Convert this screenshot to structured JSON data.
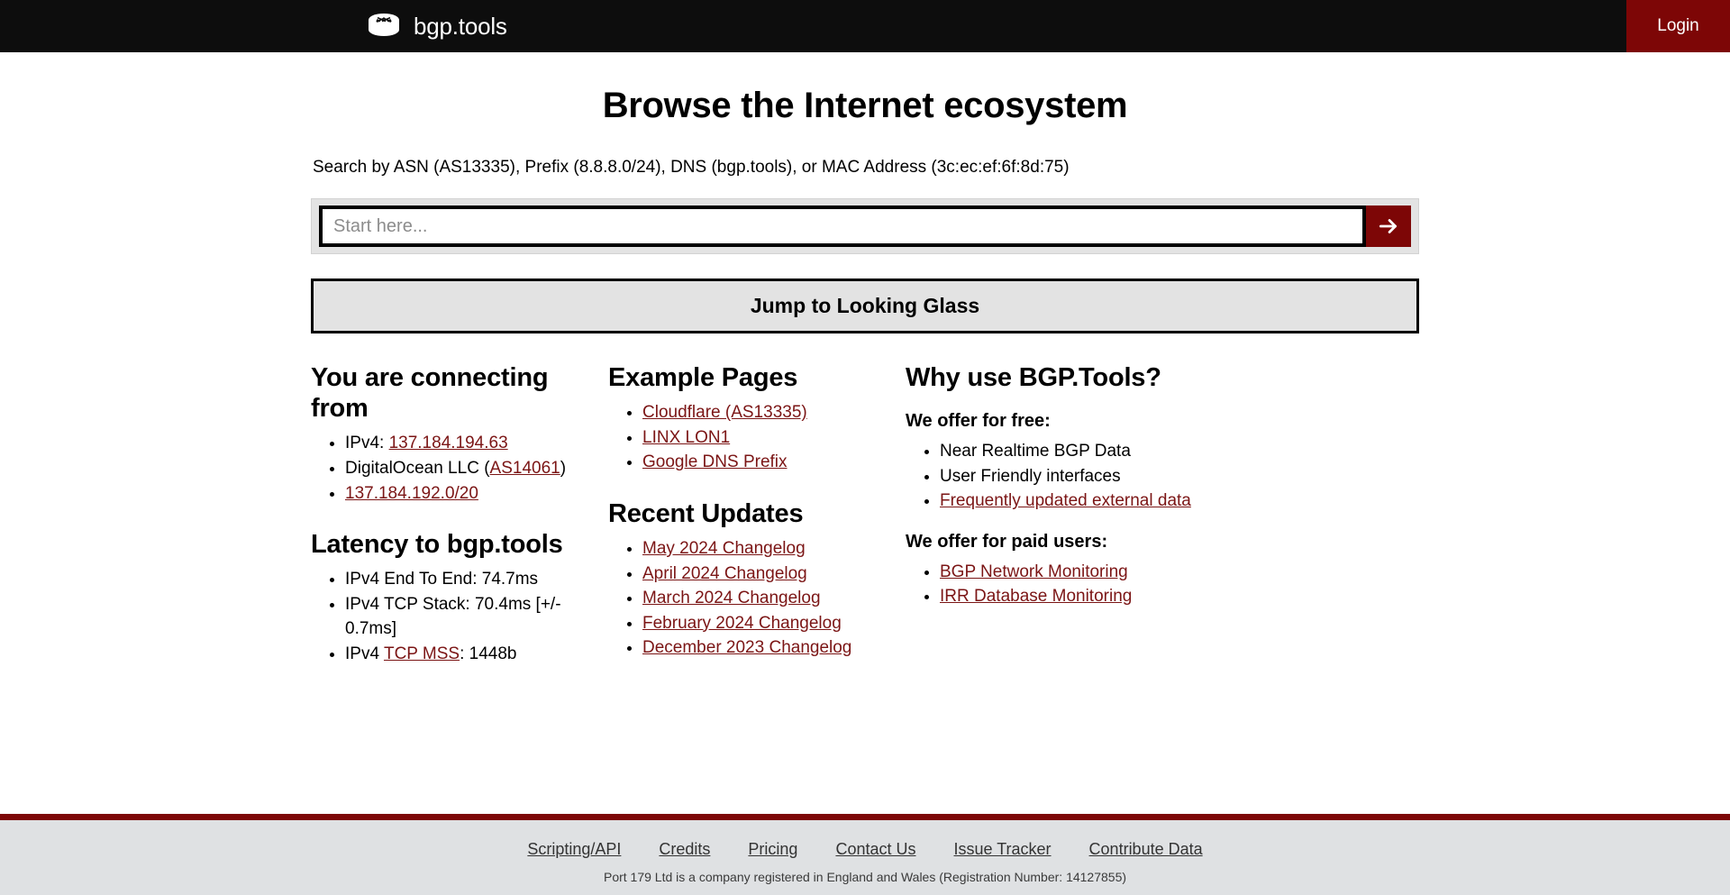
{
  "header": {
    "logo_icon": "router-icon",
    "brand": "bgp.tools",
    "login_label": "Login"
  },
  "hero": {
    "title": "Browse the Internet ecosystem",
    "search_description": "Search by ASN (AS13335), Prefix (8.8.8.0/24), DNS (bgp.tools), or MAC Address (3c:ec:ef:6f:8d:75)"
  },
  "search": {
    "placeholder": "Start here...",
    "value": "",
    "submit_icon": "arrow-right-icon"
  },
  "looking_glass": {
    "label": "Jump to Looking Glass"
  },
  "connecting_from": {
    "heading": "You are connecting from",
    "ipv4_label": "IPv4: ",
    "ipv4_value": "137.184.194.63",
    "org_name": "DigitalOcean LLC (",
    "org_asn": "AS14061",
    "org_close": ")",
    "prefix": "137.184.192.0/20"
  },
  "latency": {
    "heading": "Latency to bgp.tools",
    "end_to_end": "IPv4 End To End: 74.7ms",
    "tcp_stack": "IPv4 TCP Stack: 70.4ms [+/- 0.7ms]",
    "mss_prefix": "IPv4 ",
    "mss_link": "TCP MSS",
    "mss_value": ": 1448b"
  },
  "example_pages": {
    "heading": "Example Pages",
    "items": [
      {
        "label": "Cloudflare (AS13335)"
      },
      {
        "label": "LINX LON1"
      },
      {
        "label": "Google DNS Prefix"
      }
    ]
  },
  "recent_updates": {
    "heading": "Recent Updates",
    "items": [
      {
        "label": "May 2024 Changelog"
      },
      {
        "label": "April 2024 Changelog"
      },
      {
        "label": "March 2024 Changelog"
      },
      {
        "label": "February 2024 Changelog"
      },
      {
        "label": "December 2023 Changelog"
      }
    ]
  },
  "why_use": {
    "heading": "Why use BGP.Tools?",
    "free_heading": "We offer for free:",
    "free_items": [
      {
        "label": "Near Realtime BGP Data",
        "link": false
      },
      {
        "label": "User Friendly interfaces",
        "link": false
      },
      {
        "label": "Frequently updated external data",
        "link": true
      }
    ],
    "paid_heading": "We offer for paid users:",
    "paid_items": [
      {
        "label": "BGP Network Monitoring",
        "link": true
      },
      {
        "label": "IRR Database Monitoring",
        "link": true
      }
    ]
  },
  "footer": {
    "links": [
      {
        "label": "Scripting/API"
      },
      {
        "label": "Credits"
      },
      {
        "label": "Pricing"
      },
      {
        "label": "Contact Us"
      },
      {
        "label": "Issue Tracker"
      },
      {
        "label": "Contribute Data"
      }
    ],
    "legal": "Port 179 Ltd is a company registered in England and Wales (Registration Number: 14127855)"
  },
  "colors": {
    "header_bg": "#0d0d0d",
    "accent_red": "#7d0606",
    "link_red": "#7b1515",
    "footer_bg": "#dfe1e3",
    "control_gray": "#e3e3e3"
  }
}
